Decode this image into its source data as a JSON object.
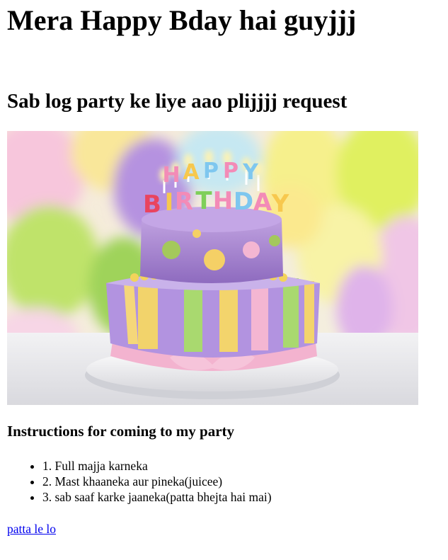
{
  "page": {
    "title": "Mera Happy Bday hai guyjjj",
    "subtitle": "Sab log party ke liye aao plijjjj request"
  },
  "photo": {
    "cake_lettering": "HAPPY BIRTHDAY",
    "icon": "birthday-cake-with-balloons"
  },
  "instructions": {
    "heading": "Instructions for coming to my party",
    "items": [
      "1. Full majja karneka",
      "2. Mast khaaneka aur pineka(juicee)",
      "3. sab saaf karke jaaneka(patta bhejta hai mai)"
    ]
  },
  "link": {
    "label": "patta le lo"
  }
}
